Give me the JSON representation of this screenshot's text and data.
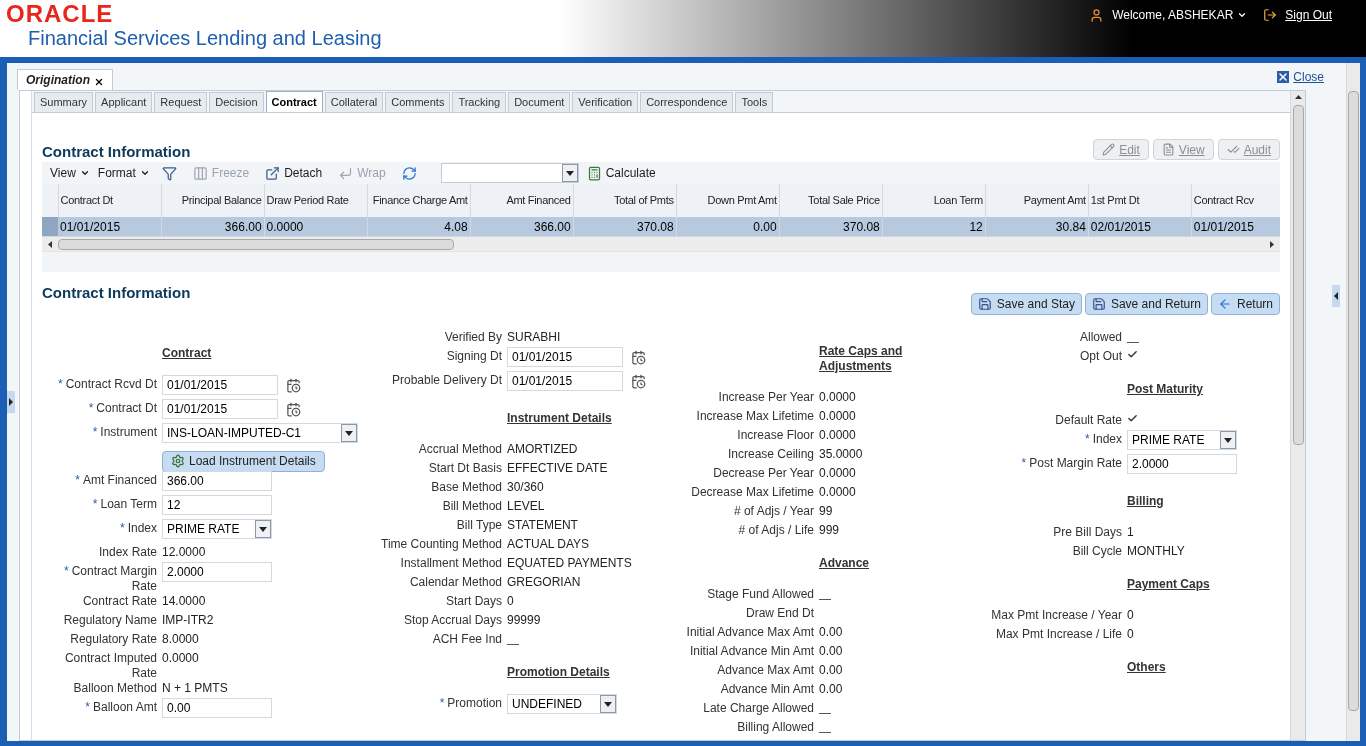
{
  "header": {
    "brand": "ORACLE",
    "product": "Financial Services Lending and Leasing",
    "welcome": "Welcome, ABSHEKAR",
    "sign_out": "Sign Out"
  },
  "page_tab": {
    "label": "Origination"
  },
  "close_link": "Close",
  "tabs": [
    {
      "label": "Summary",
      "selected": false
    },
    {
      "label": "Applicant",
      "selected": false
    },
    {
      "label": "Request",
      "selected": false
    },
    {
      "label": "Decision",
      "selected": false
    },
    {
      "label": "Contract",
      "selected": true
    },
    {
      "label": "Collateral",
      "selected": false
    },
    {
      "label": "Comments",
      "selected": false
    },
    {
      "label": "Tracking",
      "selected": false
    },
    {
      "label": "Document",
      "selected": false
    },
    {
      "label": "Verification",
      "selected": false
    },
    {
      "label": "Correspondence",
      "selected": false
    },
    {
      "label": "Tools",
      "selected": false
    }
  ],
  "grid_section": {
    "title": "Contract Information",
    "actions": [
      {
        "kind": "edit",
        "label": "Edit",
        "disabled": true
      },
      {
        "kind": "view",
        "label": "View",
        "disabled": true
      },
      {
        "kind": "audit",
        "label": "Audit",
        "disabled": true
      }
    ],
    "toolbar": [
      {
        "kind": "menu",
        "label": "View",
        "disabled": false
      },
      {
        "kind": "menu",
        "label": "Format",
        "disabled": false
      },
      {
        "kind": "filter",
        "disabled": false
      },
      {
        "kind": "freeze",
        "label": "Freeze",
        "disabled": true
      },
      {
        "kind": "detach",
        "label": "Detach",
        "disabled": false
      },
      {
        "kind": "wrap",
        "label": "Wrap",
        "disabled": true
      },
      {
        "kind": "refresh",
        "disabled": false
      },
      {
        "kind": "select"
      },
      {
        "kind": "calculate",
        "label": "Calculate",
        "disabled": false
      }
    ],
    "table": {
      "columns": [
        {
          "label": "Contract Dt",
          "kind": "text"
        },
        {
          "label": "Principal Balance",
          "kind": "number"
        },
        {
          "label": "Draw Period Rate",
          "kind": "text"
        },
        {
          "label": "Finance Charge Amt",
          "kind": "number"
        },
        {
          "label": "Amt Financed",
          "kind": "number"
        },
        {
          "label": "Total of Pmts",
          "kind": "number"
        },
        {
          "label": "Down Pmt Amt",
          "kind": "number"
        },
        {
          "label": "Total Sale Price",
          "kind": "number"
        },
        {
          "label": "Loan Term",
          "kind": "number"
        },
        {
          "label": "Payment Amt",
          "kind": "number"
        },
        {
          "label": "1st Pmt Dt",
          "kind": "text"
        },
        {
          "label": "Contract Rcv",
          "kind": "text"
        }
      ],
      "rows": [
        {
          "selected": true,
          "cells": [
            "01/01/2015",
            "366.00",
            "0.0000",
            "4.08",
            "366.00",
            "370.08",
            "0.00",
            "370.08",
            "12",
            "30.84",
            "02/01/2015",
            "01/01/2015"
          ]
        }
      ]
    }
  },
  "form": {
    "title": "Contract Information",
    "required_mark": "*",
    "buttons": [
      {
        "kind": "save",
        "label": "Save and Stay"
      },
      {
        "kind": "save",
        "label": "Save and Return"
      },
      {
        "kind": "return",
        "label": "Return"
      }
    ],
    "columns": [
      [
        {
          "kind": "heading",
          "label": "Contract"
        },
        {
          "kind": "date",
          "label": "Contract Rcvd Dt",
          "required": true,
          "value": "01/01/2015"
        },
        {
          "kind": "date",
          "label": "Contract Dt",
          "required": true,
          "value": "01/01/2015"
        },
        {
          "kind": "select",
          "label": "Instrument",
          "required": true,
          "value": "INS-LOAN-IMPUTED-C1"
        },
        {
          "kind": "button",
          "label": "Load Instrument Details"
        },
        {
          "kind": "input",
          "label": "Amt Financed",
          "required": true,
          "value": "366.00"
        },
        {
          "kind": "input",
          "label": "Loan Term",
          "required": true,
          "value": "12"
        },
        {
          "kind": "select",
          "label": "Index",
          "required": true,
          "value": "PRIME RATE"
        },
        {
          "kind": "text",
          "label": "Index Rate",
          "value": "12.0000"
        },
        {
          "kind": "input",
          "label": "Contract Margin Rate",
          "required": true,
          "value": "2.0000"
        },
        {
          "kind": "text",
          "label": "Contract Rate",
          "value": "14.0000"
        },
        {
          "kind": "text",
          "label": "Regulatory Name",
          "value": "IMP-ITR2"
        },
        {
          "kind": "text",
          "label": "Regulatory Rate",
          "value": "8.0000"
        },
        {
          "kind": "text",
          "label": "Contract Imputed Rate",
          "value": "0.0000"
        },
        {
          "kind": "text",
          "label": "Balloon Method",
          "value": "N + 1 PMTS"
        },
        {
          "kind": "input",
          "label": "Balloon Amt",
          "required": true,
          "value": "0.00"
        }
      ],
      [
        {
          "kind": "text",
          "label": "Verified By",
          "value": "SURABHI"
        },
        {
          "kind": "date",
          "label": "Signing Dt",
          "required": false,
          "value": "01/01/2015"
        },
        {
          "kind": "date",
          "label": "Probable Delivery Dt",
          "required": false,
          "value": "01/01/2015"
        },
        {
          "kind": "heading",
          "label": "Instrument Details"
        },
        {
          "kind": "text",
          "label": "Accrual Method",
          "value": "AMORTIZED"
        },
        {
          "kind": "text",
          "label": "Start Dt Basis",
          "value": "EFFECTIVE DATE"
        },
        {
          "kind": "text",
          "label": "Base Method",
          "value": "30/360"
        },
        {
          "kind": "text",
          "label": "Bill Method",
          "value": "LEVEL"
        },
        {
          "kind": "text",
          "label": "Bill Type",
          "value": "STATEMENT"
        },
        {
          "kind": "text",
          "label": "Time Counting Method",
          "value": "ACTUAL DAYS"
        },
        {
          "kind": "text",
          "label": "Installment Method",
          "value": "EQUATED PAYMENTS"
        },
        {
          "kind": "text",
          "label": "Calendar Method",
          "value": "GREGORIAN"
        },
        {
          "kind": "text",
          "label": "Start Days",
          "value": "0"
        },
        {
          "kind": "text",
          "label": "Stop Accrual Days",
          "value": "99999"
        },
        {
          "kind": "check",
          "label": "ACH Fee Ind",
          "checked": false
        },
        {
          "kind": "heading",
          "label": "Promotion Details"
        },
        {
          "kind": "select",
          "label": "Promotion",
          "required": true,
          "value": "UNDEFINED"
        }
      ],
      [
        {
          "kind": "heading",
          "label": "Rate Caps and Adjustments"
        },
        {
          "kind": "text",
          "label": "Increase Per Year",
          "value": "0.0000"
        },
        {
          "kind": "text",
          "label": "Increase Max Lifetime",
          "value": "0.0000"
        },
        {
          "kind": "text",
          "label": "Increase Floor",
          "value": "0.0000"
        },
        {
          "kind": "text",
          "label": "Increase Ceiling",
          "value": "35.0000"
        },
        {
          "kind": "text",
          "label": "Decrease Per Year",
          "value": "0.0000"
        },
        {
          "kind": "text",
          "label": "Decrease Max Lifetime",
          "value": "0.0000"
        },
        {
          "kind": "text",
          "label": "# of Adjs / Year",
          "value": "99"
        },
        {
          "kind": "text",
          "label": "# of Adjs / Life",
          "value": "999"
        },
        {
          "kind": "heading",
          "label": "Advance"
        },
        {
          "kind": "check",
          "label": "Stage Fund Allowed",
          "checked": false
        },
        {
          "kind": "text",
          "label": "Draw End Dt"
        },
        {
          "kind": "text",
          "label": "Initial Advance Max Amt",
          "value": "0.00"
        },
        {
          "kind": "text",
          "label": "Initial Advance Min Amt",
          "value": "0.00"
        },
        {
          "kind": "text",
          "label": "Advance Max Amt",
          "value": "0.00"
        },
        {
          "kind": "text",
          "label": "Advance Min Amt",
          "value": "0.00"
        },
        {
          "kind": "check",
          "label": "Late Charge Allowed",
          "checked": false
        },
        {
          "kind": "check",
          "label": "Billing Allowed",
          "checked": false
        }
      ],
      [
        {
          "kind": "check",
          "label": "Allowed",
          "checked": false
        },
        {
          "kind": "check",
          "label": "Opt Out",
          "checked": true
        },
        {
          "kind": "heading",
          "label": "Post Maturity"
        },
        {
          "kind": "check",
          "label": "Default Rate",
          "checked": true
        },
        {
          "kind": "select",
          "label": "Index",
          "required": true,
          "value": "PRIME RATE"
        },
        {
          "kind": "input",
          "label": "Post Margin Rate",
          "required": true,
          "value": "2.0000"
        },
        {
          "kind": "heading",
          "label": "Billing"
        },
        {
          "kind": "text",
          "label": "Pre Bill Days",
          "value": "1"
        },
        {
          "kind": "text",
          "label": "Bill Cycle",
          "value": "MONTHLY"
        },
        {
          "kind": "heading",
          "label": "Payment Caps"
        },
        {
          "kind": "text",
          "label": "Max Pmt Increase / Year",
          "value": "0"
        },
        {
          "kind": "text",
          "label": "Max Pmt Increase / Life",
          "value": "0"
        },
        {
          "kind": "heading",
          "label": "Others"
        }
      ]
    ]
  }
}
